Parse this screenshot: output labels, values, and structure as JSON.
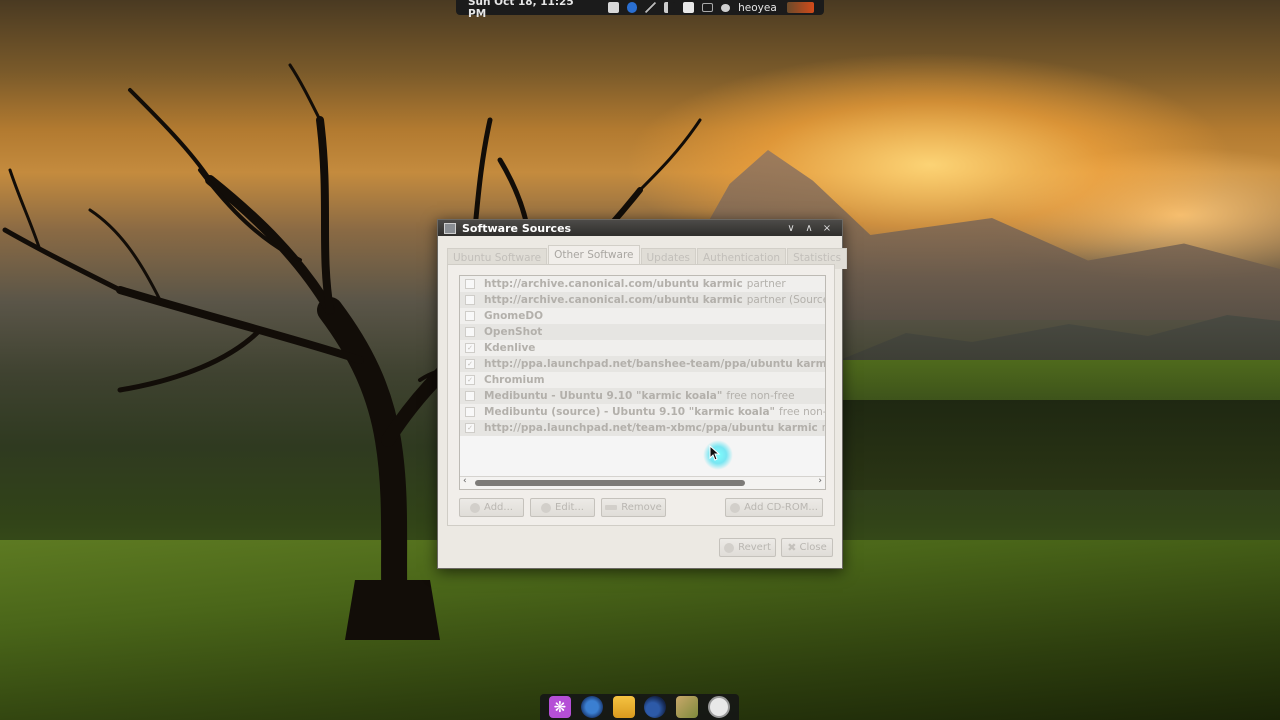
{
  "top_panel": {
    "clock": "Sun Oct 18, 11:25 PM",
    "user": "heoyea",
    "icons": [
      "notes-icon",
      "hp-icon",
      "network-icon",
      "volume-icon",
      "clipboard-icon",
      "mail-icon",
      "chat-icon",
      "session-icon"
    ]
  },
  "window": {
    "title": "Software Sources",
    "controls": {
      "minimize": "∨",
      "maximize": "∧",
      "close": "×"
    },
    "tabs": [
      {
        "label": "Ubuntu Software",
        "active": false
      },
      {
        "label": "Other Software",
        "active": true
      },
      {
        "label": "Updates",
        "active": false
      },
      {
        "label": "Authentication",
        "active": false
      },
      {
        "label": "Statistics",
        "active": false
      }
    ],
    "sources": [
      {
        "name": "http://archive.canonical.com/ubuntu karmic",
        "extra": "partner",
        "checked": false
      },
      {
        "name": "http://archive.canonical.com/ubuntu karmic",
        "extra": "partner (Source Co",
        "checked": false
      },
      {
        "name": "GnomeDO",
        "extra": "",
        "checked": false
      },
      {
        "name": "OpenShot",
        "extra": "",
        "checked": false
      },
      {
        "name": "Kdenlive",
        "extra": "",
        "checked": true
      },
      {
        "name": "http://ppa.launchpad.net/banshee-team/ppa/ubuntu karmic",
        "extra": "",
        "checked": true
      },
      {
        "name": "Chromium",
        "extra": "",
        "checked": true
      },
      {
        "name": "Medibuntu - Ubuntu 9.10 \"karmic koala\"",
        "extra": "free non-free",
        "checked": false
      },
      {
        "name": "Medibuntu (source) - Ubuntu 9.10 \"karmic koala\"",
        "extra": "free non-fre",
        "checked": false
      },
      {
        "name": "http://ppa.launchpad.net/team-xbmc/ppa/ubuntu karmic",
        "extra": "ma",
        "checked": true
      }
    ],
    "buttons": {
      "add": "Add...",
      "edit": "Edit...",
      "remove": "Remove",
      "add_cdrom": "Add CD-ROM...",
      "revert": "Revert",
      "close": "Close"
    }
  },
  "dock": {
    "items": [
      "app-launcher-icon",
      "browser-icon",
      "files-icon",
      "media-icon",
      "archive-icon",
      "clock-icon"
    ]
  }
}
